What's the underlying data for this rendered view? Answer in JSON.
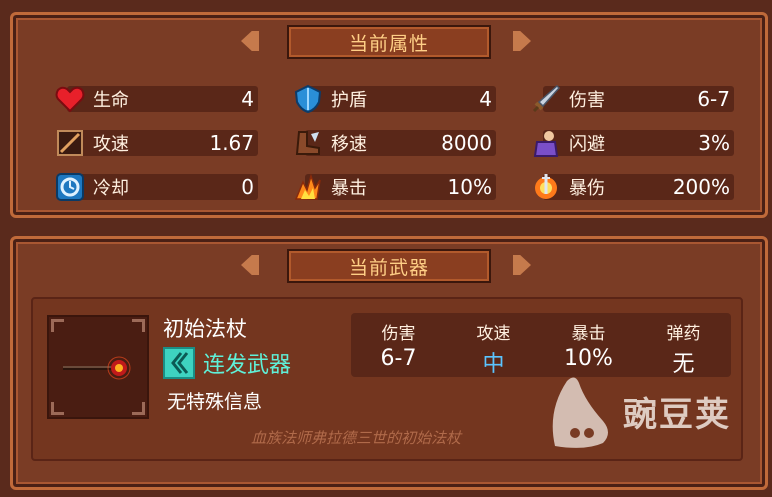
{
  "stats_panel": {
    "title": "当前属性",
    "stats": [
      {
        "label": "生命",
        "value": "4",
        "icon": "heart-icon"
      },
      {
        "label": "护盾",
        "value": "4",
        "icon": "shield-icon"
      },
      {
        "label": "伤害",
        "value": "6-7",
        "icon": "sword-icon"
      },
      {
        "label": "攻速",
        "value": "1.67",
        "icon": "attack-speed-icon"
      },
      {
        "label": "移速",
        "value": "8000",
        "icon": "boot-icon"
      },
      {
        "label": "闪避",
        "value": "3%",
        "icon": "dodge-icon"
      },
      {
        "label": "冷却",
        "value": "0",
        "icon": "cooldown-icon"
      },
      {
        "label": "暴击",
        "value": "10%",
        "icon": "crit-icon"
      },
      {
        "label": "暴伤",
        "value": "200%",
        "icon": "crit-damage-icon"
      }
    ]
  },
  "weapon_panel": {
    "title": "当前武器",
    "weapon_name": "初始法杖",
    "weapon_type": "连发武器",
    "info": "无特殊信息",
    "description": "血族法师弗拉德三世的初始法杖",
    "stats": [
      {
        "label": "伤害",
        "value": "6-7"
      },
      {
        "label": "攻速",
        "value": "中"
      },
      {
        "label": "暴击",
        "value": "10%"
      },
      {
        "label": "弹药",
        "value": "无"
      }
    ]
  },
  "watermark": {
    "text": "豌豆荚"
  },
  "colors": {
    "accent": "#ffcf86",
    "teal": "#5ff0d8",
    "blue": "#5bc4ff"
  }
}
